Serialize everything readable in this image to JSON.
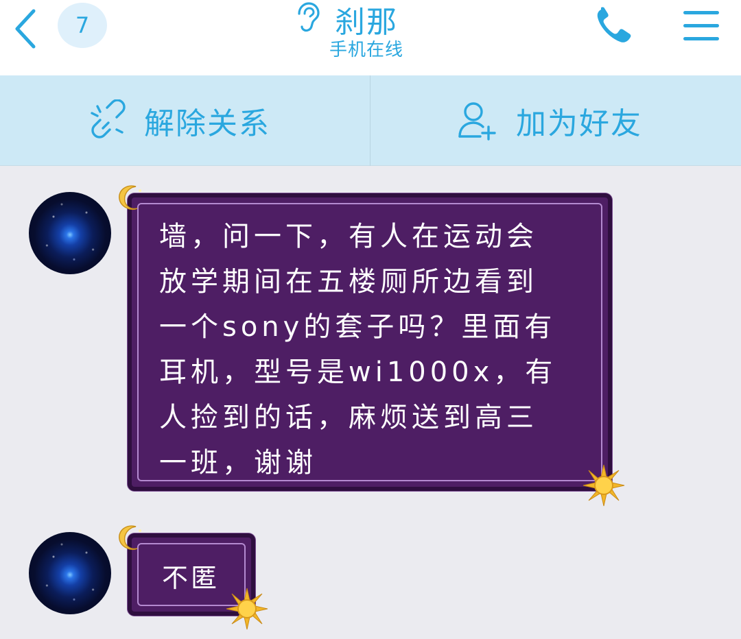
{
  "header": {
    "back_icon": "chevron-left-icon",
    "unread_badge": "7",
    "contact_name": "刹那",
    "contact_status": "手机在线",
    "status_icon": "ear-icon",
    "call_icon": "phone-icon",
    "menu_icon": "menu-icon"
  },
  "actions": {
    "unlink_label": "解除关系",
    "unlink_icon": "unlink-icon",
    "add_friend_label": "加为好友",
    "add_friend_icon": "add-user-icon"
  },
  "messages": [
    {
      "sender_avatar": "avatar",
      "text": "墙，问一下，有人在运动会\n放学期间在五楼厕所边看到\n一个sony的套子吗？里面有\n耳机，型号是wi1000x，有\n人捡到的话，麻烦送到高三\n一班，谢谢"
    },
    {
      "sender_avatar": "avatar",
      "text": "不匿"
    }
  ],
  "colors": {
    "accent": "#2aa7df",
    "action_bar_bg": "#cde9f6",
    "chat_bg": "#ebebf0",
    "bubble_bg": "#4e1e64",
    "bubble_border": "#2f0f3f"
  }
}
